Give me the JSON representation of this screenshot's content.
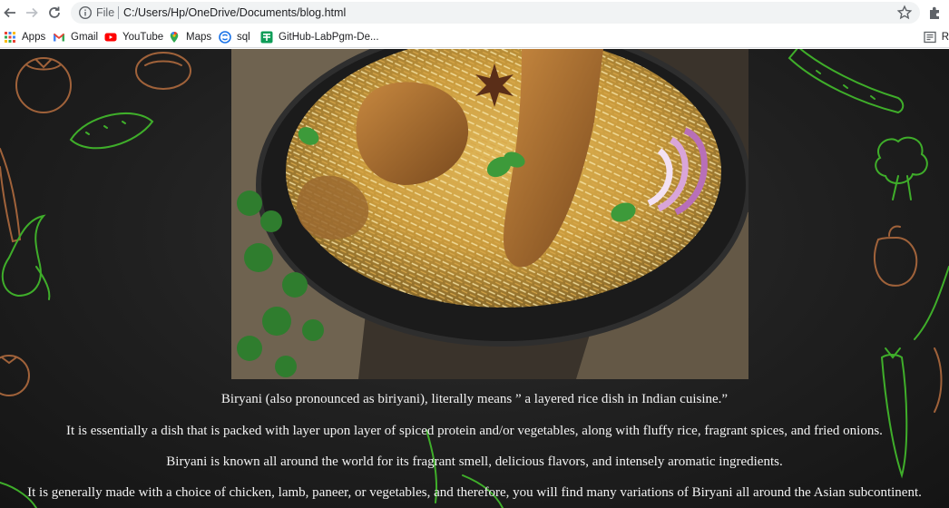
{
  "browser": {
    "scheme_label": "File",
    "url": "C:/Users/Hp/OneDrive/Documents/blog.html"
  },
  "bookmarks": [
    {
      "label": "Apps",
      "icon": "apps-grid-icon"
    },
    {
      "label": "Gmail",
      "icon": "gmail-icon"
    },
    {
      "label": "YouTube",
      "icon": "youtube-icon"
    },
    {
      "label": "Maps",
      "icon": "maps-icon"
    },
    {
      "label": "sql",
      "icon": "sql-icon"
    },
    {
      "label": "GitHub-LabPgm-De...",
      "icon": "github-icon"
    }
  ],
  "reading_list": {
    "label": "R",
    "icon": "reading-list-icon"
  },
  "article": {
    "image": {
      "description_icon": "biryani-photo"
    },
    "paragraphs": [
      "Biryani (also pronounced as biriyani), literally means ” a layered rice dish in Indian cuisine.”",
      "It is essentially a dish that is packed with layer upon layer of spiced protein and/or vegetables, along with fluffy rice, fragrant spices, and fried onions.",
      "Biryani is known all around the world for its fragrant smell, delicious flavors, and intensely aromatic ingredients.",
      "It is generally made with a choice of chicken, lamb, paneer, or vegetables, and therefore, you will find many variations of Biryani all around the Asian subcontinent."
    ]
  },
  "colors": {
    "page_background": "#1f1f1f",
    "doodle_brown": "#a0623a",
    "doodle_green": "#3fae2a",
    "text": "#f2f2f2"
  }
}
